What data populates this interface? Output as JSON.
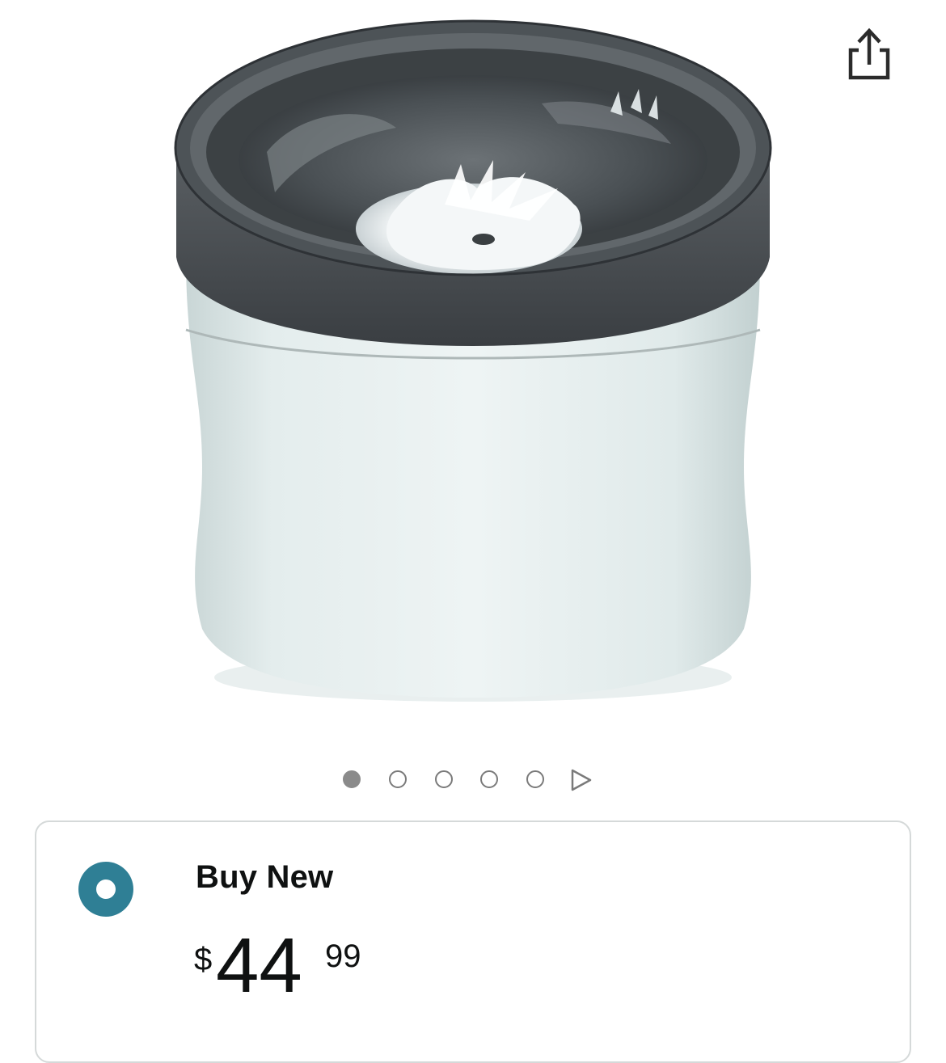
{
  "header": {
    "share_icon": "share-icon"
  },
  "product": {
    "image_description_icon": "product-image"
  },
  "carousel": {
    "total_images": 5,
    "active_index": 0,
    "play_icon": "play-triangle-icon"
  },
  "buy_box": {
    "option_label": "Buy New",
    "selected": true,
    "price": {
      "currency_symbol": "$",
      "whole": "44",
      "fraction": "99"
    },
    "accent_color": "#2f7f95"
  }
}
